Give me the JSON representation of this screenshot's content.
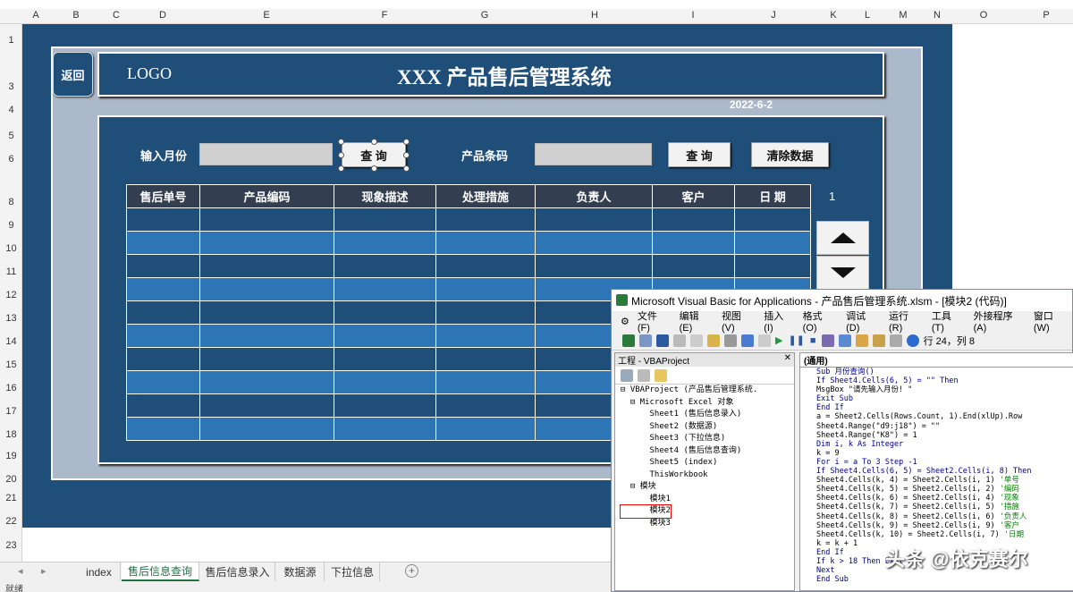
{
  "columns": [
    "A",
    "B",
    "C",
    "D",
    "E",
    "F",
    "G",
    "H",
    "I",
    "J",
    "K",
    "L",
    "M",
    "N",
    "O",
    "P"
  ],
  "rows": [
    "1",
    "3",
    "4",
    "5",
    "6",
    "8",
    "9",
    "10",
    "11",
    "12",
    "13",
    "14",
    "15",
    "16",
    "17",
    "18",
    "19",
    "20",
    "21",
    "22",
    "23"
  ],
  "dashboard": {
    "back_label": "返回",
    "logo_text": "LOGO",
    "title": "XXX 产品售后管理系统",
    "date": "2022-6-2",
    "month_label": "输入月份",
    "query_label": "查 询",
    "barcode_label": "产品条码",
    "query2_label": "查 询",
    "clear_label": "清除数据",
    "page_num": "1",
    "table_headers": [
      "售后单号",
      "产品编码",
      "现象描述",
      "处理措施",
      "负责人",
      "客户",
      "日 期"
    ],
    "row_count": 10
  },
  "sheet_tabs": {
    "tabs": [
      "index",
      "售后信息查询",
      "售后信息录入",
      "数据源",
      "下拉信息"
    ],
    "active": "售后信息查询"
  },
  "status": {
    "text": "就绪"
  },
  "vba": {
    "title": "Microsoft Visual Basic for Applications - 产品售后管理系统.xlsm - [模块2 (代码)]",
    "menu": [
      "文件(F)",
      "编辑(E)",
      "视图(V)",
      "插入(I)",
      "格式(O)",
      "调试(D)",
      "运行(R)",
      "工具(T)",
      "外接程序(A)",
      "窗口(W)"
    ],
    "cursor_pos": "行 24，列 8",
    "project_title": "工程 - VBAProject",
    "tree": [
      "⊟ VBAProject (产品售后管理系统.",
      "  ⊟ Microsoft Excel 对象",
      "      Sheet1 (售后信息录入)",
      "      Sheet2 (数据源)",
      "      Sheet3 (下拉信息)",
      "      Sheet4 (售后信息查询)",
      "      Sheet5 (index)",
      "      ThisWorkbook",
      "  ⊟ 模块",
      "      模块1",
      "      模块2",
      "      模块3"
    ],
    "code_selector": "(通用)",
    "code_lines": [
      "Sub 月份查询()",
      "If Sheet4.Cells(6, 5) = \"\" Then",
      "MsgBox \"请先输入月份! \"",
      "Exit Sub",
      "End If",
      "a = Sheet2.Cells(Rows.Count, 1).End(xlUp).Row",
      "Sheet4.Range(\"d9:j18\") = \"\"",
      "Sheet4.Range(\"K8\") = 1",
      "Dim i, k As Integer",
      "k = 9",
      "For i = a To 3 Step -1",
      "If Sheet4.Cells(6, 5) = Sheet2.Cells(i, 8) Then",
      "Sheet4.Cells(k, 4) = Sheet2.Cells(i, 1) '单号",
      "Sheet4.Cells(k, 5) = Sheet2.Cells(i, 2) '编码",
      "Sheet4.Cells(k, 6) = Sheet2.Cells(i, 4) '现象",
      "Sheet4.Cells(k, 7) = Sheet2.Cells(i, 5) '措施",
      "Sheet4.Cells(k, 8) = Sheet2.Cells(i, 6) '负责人",
      "Sheet4.Cells(k, 9) = Sheet2.Cells(i, 9) '客户",
      "Sheet4.Cells(k, 10) = Sheet2.Cells(i, 7) '日期",
      "k = k + 1",
      "End If",
      "If k > 18 Then Exit For",
      "Next",
      "End Sub"
    ]
  },
  "watermark": "头条 @依克赛尔"
}
